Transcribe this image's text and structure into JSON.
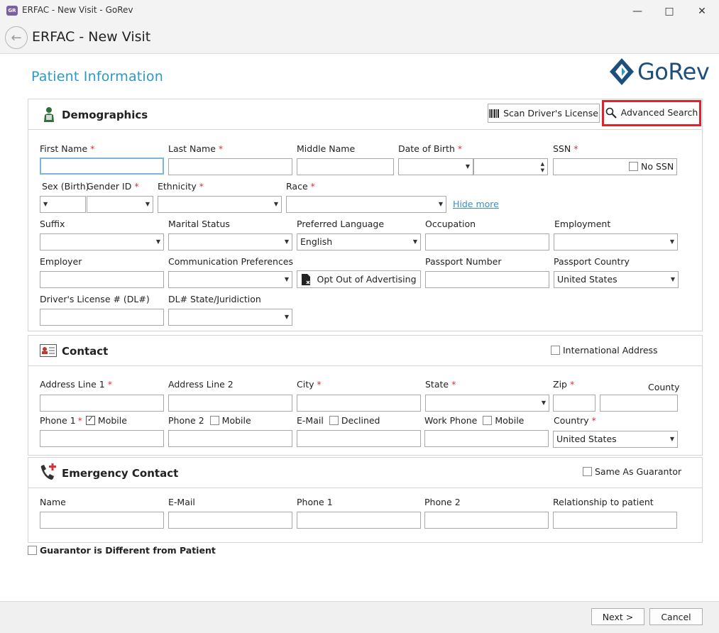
{
  "window": {
    "title": "ERFAC - New Visit - GoRev",
    "app_icon_text": "GoRev"
  },
  "header": {
    "title": "ERFAC - New Visit"
  },
  "page": {
    "section_title": "Patient Information",
    "logo": "GoRev"
  },
  "demographics": {
    "title": "Demographics",
    "scan_button": "Scan Driver's License",
    "advanced_search_button": "Advanced Search",
    "first_name": "First Name",
    "last_name": "Last Name",
    "middle_name": "Middle Name",
    "dob": "Date of Birth",
    "ssn": "SSN",
    "no_ssn": "No SSN",
    "sex_birth": "Sex (Birth)",
    "gender_id": "Gender ID",
    "ethnicity": "Ethnicity",
    "race": "Race",
    "hide_more": "Hide more",
    "suffix": "Suffix",
    "marital_status": "Marital Status",
    "preferred_language": "Preferred Language",
    "preferred_language_value": "English",
    "occupation": "Occupation",
    "employment": "Employment",
    "employer": "Employer",
    "communication_preferences": "Communication Preferences",
    "opt_out_button": "Opt Out of Advertising",
    "passport_number": "Passport Number",
    "passport_country": "Passport Country",
    "passport_country_value": "United States",
    "drivers_license": "Driver's License # (DL#)",
    "dl_state": "DL# State/Juridiction"
  },
  "contact": {
    "title": "Contact",
    "international_address": "International Address",
    "address1": "Address Line 1",
    "address2": "Address Line 2",
    "city": "City",
    "state": "State",
    "zip": "Zip",
    "county": "County",
    "phone1": "Phone 1",
    "phone1_mobile": "Mobile",
    "phone2": "Phone 2",
    "phone2_mobile": "Mobile",
    "email": "E-Mail",
    "email_declined": "Declined",
    "work_phone": "Work Phone",
    "work_mobile": "Mobile",
    "country": "Country",
    "country_value": "United States"
  },
  "emergency": {
    "title": "Emergency Contact",
    "same_as_guarantor": "Same As Guarantor",
    "name": "Name",
    "email": "E-Mail",
    "phone1": "Phone 1",
    "phone2": "Phone 2",
    "relationship": "Relationship to patient"
  },
  "guarantor_different": "Guarantor is Different from Patient",
  "footer": {
    "next": "Next >",
    "cancel": "Cancel"
  },
  "colors": {
    "accent": "#2a9bc4",
    "required": "#d9303a",
    "highlight_border": "#e0222b",
    "logo": "#1d4f7c"
  }
}
